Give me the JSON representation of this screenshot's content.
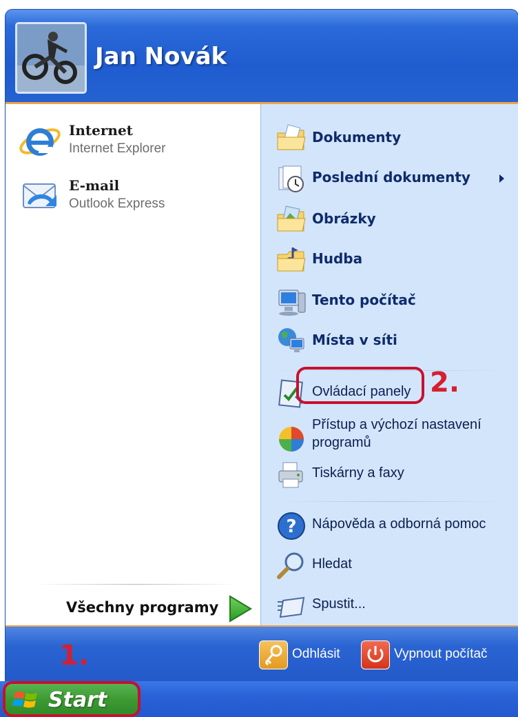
{
  "header": {
    "user_name": "Jan Novák"
  },
  "left_pinned": [
    {
      "title": "Internet",
      "subtitle": "Internet Explorer",
      "icon": "internet-explorer-icon"
    },
    {
      "title": "E-mail",
      "subtitle": "Outlook Express",
      "icon": "outlook-express-icon"
    }
  ],
  "all_programs": {
    "label": "Všechny programy"
  },
  "right_items": [
    {
      "label": "Dokumenty",
      "icon": "documents-folder-icon"
    },
    {
      "label": "Poslední dokumenty",
      "icon": "recent-documents-icon"
    },
    {
      "label": "Obrázky",
      "icon": "pictures-folder-icon"
    },
    {
      "label": "Hudba",
      "icon": "music-folder-icon"
    },
    {
      "label": "Tento počítač",
      "icon": "my-computer-icon"
    },
    {
      "label": "Místa v síti",
      "icon": "network-places-icon"
    },
    {
      "label": "Ovládací panely",
      "icon": "control-panel-icon"
    },
    {
      "label": "Přístup a výchozí nastavení",
      "label2": "programů",
      "icon": "program-access-icon"
    },
    {
      "label": "Tiskárny a faxy",
      "icon": "printers-icon"
    },
    {
      "label": "Nápověda a odborná pomoc",
      "icon": "help-icon"
    },
    {
      "label": "Hledat",
      "icon": "search-icon"
    },
    {
      "label": "Spustit...",
      "icon": "run-icon"
    }
  ],
  "footer": {
    "logoff_label": "Odhlásit",
    "shutdown_label": "Vypnout počítač"
  },
  "taskbar": {
    "start_label": "Start"
  },
  "annotations": {
    "step1": "1.",
    "step2": "2.",
    "color": "#d61f2f"
  }
}
